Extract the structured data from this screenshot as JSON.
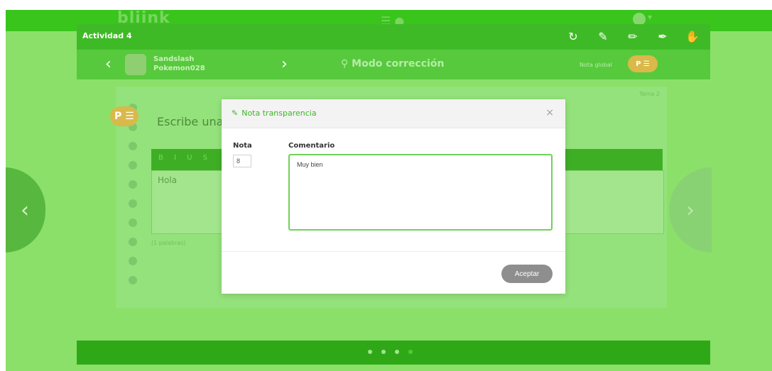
{
  "app": {
    "brand": "bliink"
  },
  "activity": {
    "title": "Actividad 4",
    "tools": [
      "refresh-icon",
      "pencil-outline-icon",
      "pencil-icon",
      "marker-icon",
      "hand-icon"
    ]
  },
  "student": {
    "name_line1": "Sandslash",
    "name_line2": "Pokemon028",
    "mode_label": "Modo corrección",
    "nota_global_label": "Nota global",
    "badge": "P ☰"
  },
  "content": {
    "tema_label": "Tema 2",
    "prompt": "Escribe una",
    "editor_buttons": "B I U S",
    "answer": "Hola",
    "word_count": "(1 palabras)",
    "left_badge": "P ☰"
  },
  "modal": {
    "title": "Nota transparencia",
    "close": "×",
    "nota_label": "Nota",
    "nota_value": "8",
    "comentario_label": "Comentario",
    "comentario_value": "Muy bien",
    "accept_label": "Aceptar"
  },
  "pagination": {
    "count": 4,
    "active_index": 3
  },
  "colors": {
    "overlay_green": "#8be06a",
    "bar_green": "#3fba27",
    "accent_green": "#3fb52a",
    "badge_gold": "#d9b94a",
    "button_gray": "#8e8e8e"
  }
}
